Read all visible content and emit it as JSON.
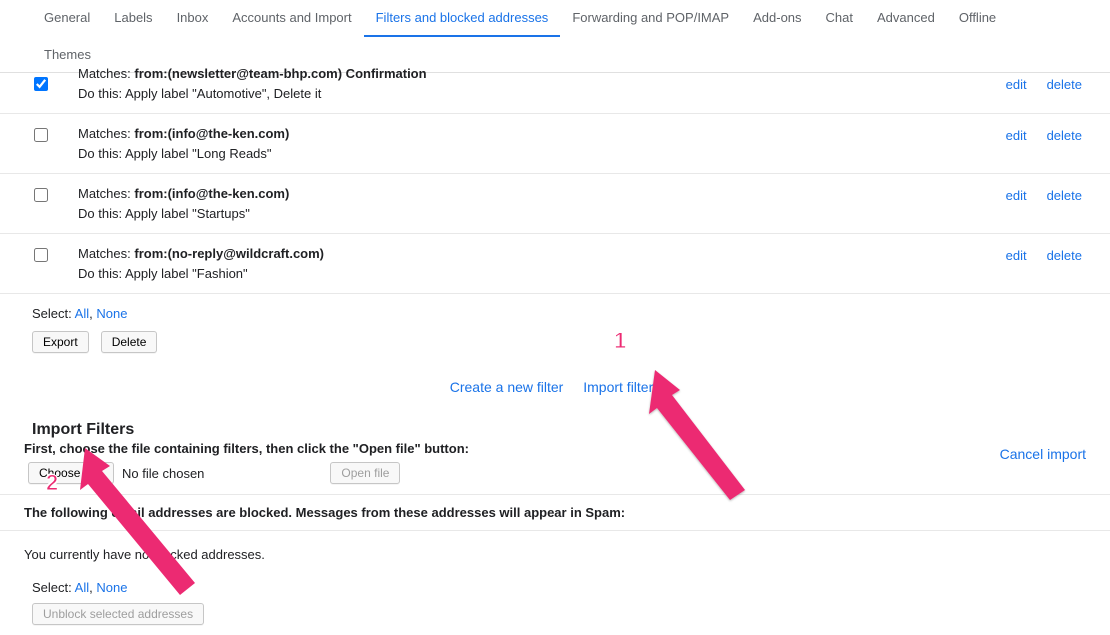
{
  "tabs": {
    "general": "General",
    "labels": "Labels",
    "inbox": "Inbox",
    "accounts": "Accounts and Import",
    "filters": "Filters and blocked addresses",
    "forwarding": "Forwarding and POP/IMAP",
    "addons": "Add-ons",
    "chat": "Chat",
    "advanced": "Advanced",
    "offline": "Offline",
    "themes": "Themes"
  },
  "filters": [
    {
      "matches_label": "Matches:",
      "matches_value": "from:(newsletter@team-bhp.com) Confirmation",
      "dothis": "Do this: Apply label \"Automotive\", Delete it",
      "checked": true,
      "edit": "edit",
      "delete": "delete"
    },
    {
      "matches_label": "Matches:",
      "matches_value": "from:(info@the-ken.com)",
      "dothis": "Do this: Apply label \"Long Reads\"",
      "checked": false,
      "edit": "edit",
      "delete": "delete"
    },
    {
      "matches_label": "Matches:",
      "matches_value": "from:(info@the-ken.com)",
      "dothis": "Do this: Apply label \"Startups\"",
      "checked": false,
      "edit": "edit",
      "delete": "delete"
    },
    {
      "matches_label": "Matches:",
      "matches_value": "from:(no-reply@wildcraft.com)",
      "dothis": "Do this: Apply label \"Fashion\"",
      "checked": false,
      "edit": "edit",
      "delete": "delete"
    }
  ],
  "select_bar": {
    "label": "Select:",
    "all": "All",
    "comma": ",",
    "none": "None"
  },
  "export_btn": "Export",
  "delete_btn": "Delete",
  "center": {
    "create": "Create a new filter",
    "import": "Import filters"
  },
  "import_section": {
    "heading": "Import Filters",
    "instruction": "First, choose the file containing filters, then click the \"Open file\" button:",
    "choose_file": "Choose File",
    "no_file": "No file chosen",
    "open_file": "Open file",
    "cancel": "Cancel import"
  },
  "blocked": {
    "heading": "The following email addresses are blocked. Messages from these addresses will appear in Spam:",
    "empty": "You currently have no blocked addresses.",
    "select_label": "Select:",
    "all": "All",
    "comma": ",",
    "none": "None",
    "unblock": "Unblock selected addresses"
  },
  "annotations": {
    "num1": "1",
    "num2": "2"
  }
}
